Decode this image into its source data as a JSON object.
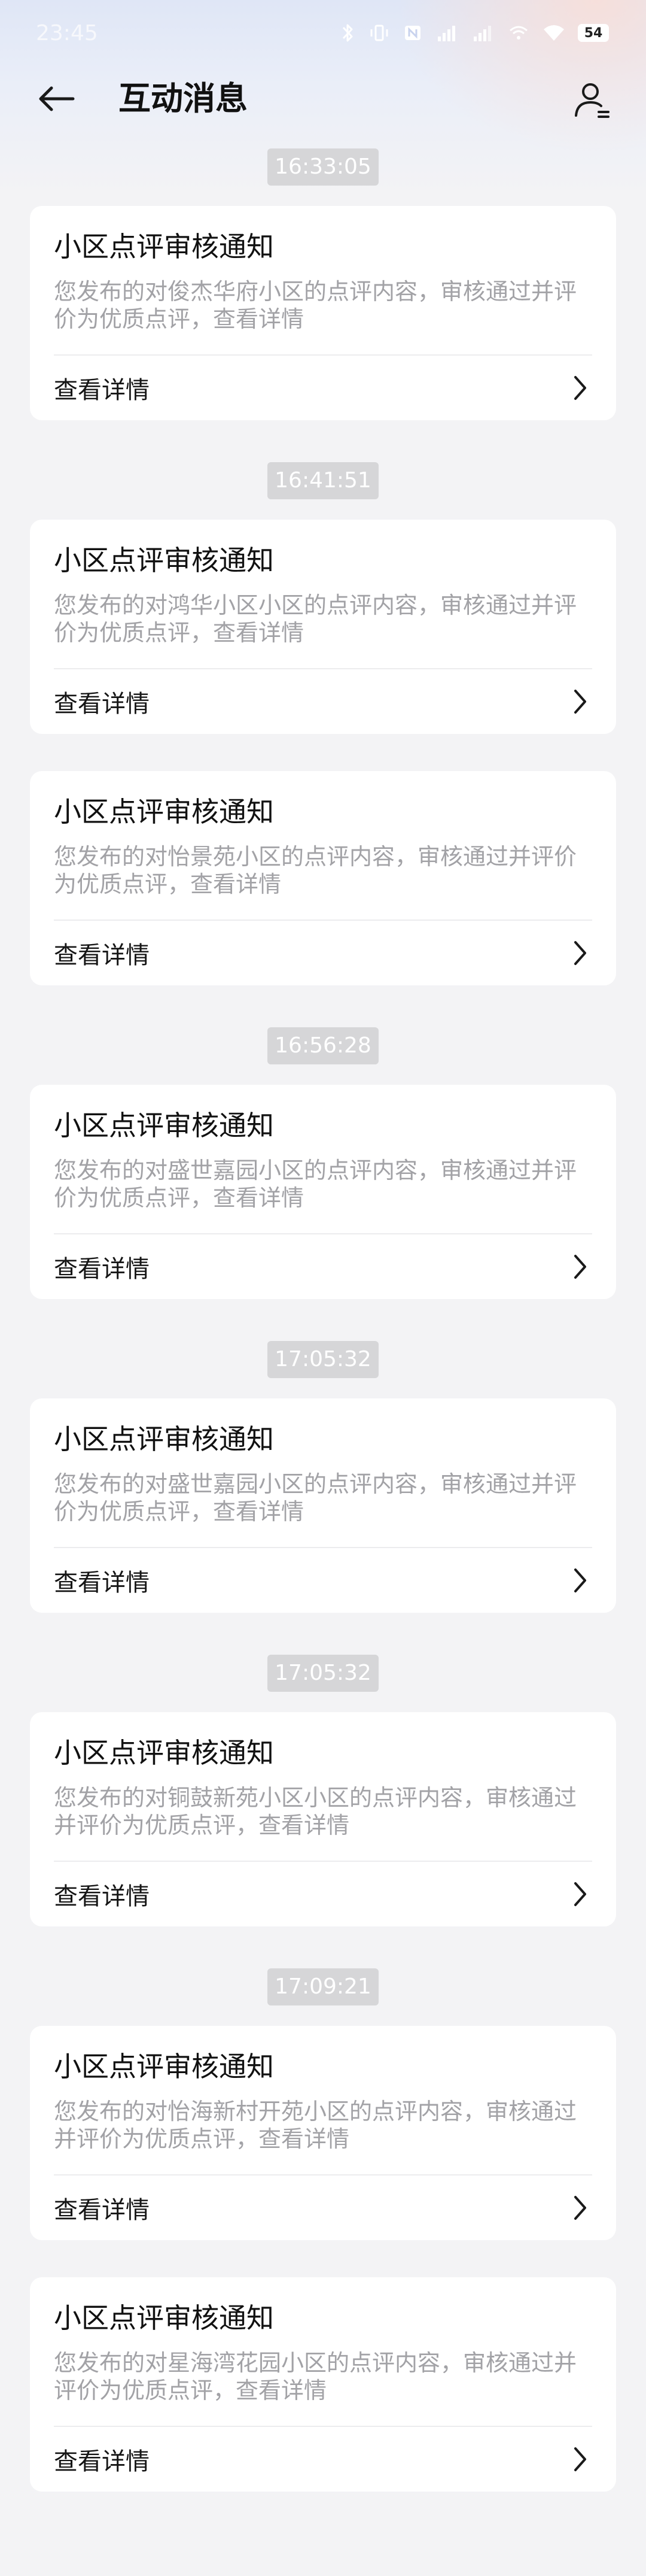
{
  "status_bar": {
    "time": "23:45",
    "battery": "54"
  },
  "header": {
    "title": "互动消息"
  },
  "feed": [
    {
      "timestamp": "16:33:05",
      "title": "小区点评审核通知",
      "desc": "您发布的对俊杰华府小区的点评内容，审核通过并评价为优质点评，查看详情",
      "link": "查看详情"
    },
    {
      "timestamp": "16:41:51",
      "title": "小区点评审核通知",
      "desc": "您发布的对鸿华小区小区的点评内容，审核通过并评价为优质点评，查看详情",
      "link": "查看详情"
    },
    {
      "timestamp": "",
      "title": "小区点评审核通知",
      "desc": "您发布的对怡景苑小区的点评内容，审核通过并评价为优质点评，查看详情",
      "link": "查看详情"
    },
    {
      "timestamp": "16:56:28",
      "title": "小区点评审核通知",
      "desc": "您发布的对盛世嘉园小区的点评内容，审核通过并评价为优质点评，查看详情",
      "link": "查看详情"
    },
    {
      "timestamp": "17:05:32",
      "title": "小区点评审核通知",
      "desc": "您发布的对盛世嘉园小区的点评内容，审核通过并评价为优质点评，查看详情",
      "link": "查看详情"
    },
    {
      "timestamp": "17:05:32",
      "title": "小区点评审核通知",
      "desc": "您发布的对铜鼓新苑小区小区的点评内容，审核通过并评价为优质点评，查看详情",
      "link": "查看详情"
    },
    {
      "timestamp": "17:09:21",
      "title": "小区点评审核通知",
      "desc": "您发布的对怡海新村开苑小区的点评内容，审核通过并评价为优质点评，查看详情",
      "link": "查看详情"
    },
    {
      "timestamp": "",
      "title": "小区点评审核通知",
      "desc": "您发布的对星海湾花园小区的点评内容，审核通过并评价为优质点评，查看详情",
      "link": "查看详情"
    }
  ]
}
